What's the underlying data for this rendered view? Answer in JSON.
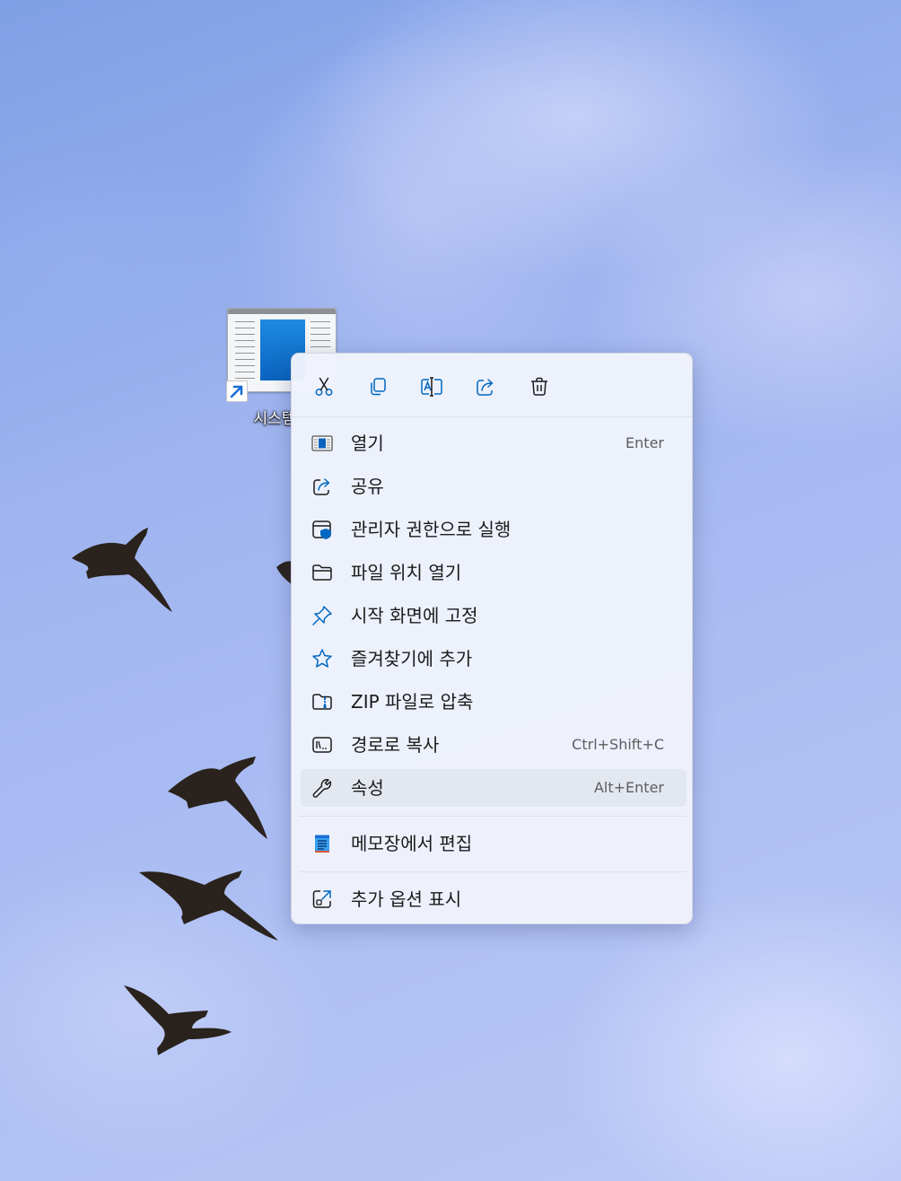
{
  "desktop": {
    "icon_label": "시스템"
  },
  "menu": {
    "toolbar": [
      {
        "name": "cut-icon"
      },
      {
        "name": "copy-icon"
      },
      {
        "name": "rename-icon"
      },
      {
        "name": "share-icon"
      },
      {
        "name": "delete-icon"
      }
    ],
    "items": [
      {
        "label": "열기",
        "shortcut": "Enter",
        "icon": "app-window-icon"
      },
      {
        "label": "공유",
        "shortcut": "",
        "icon": "share-icon"
      },
      {
        "label": "관리자 권한으로 실행",
        "shortcut": "",
        "icon": "admin-shield-icon"
      },
      {
        "label": "파일 위치 열기",
        "shortcut": "",
        "icon": "folder-icon"
      },
      {
        "label": "시작 화면에 고정",
        "shortcut": "",
        "icon": "pin-icon"
      },
      {
        "label": "즐겨찾기에 추가",
        "shortcut": "",
        "icon": "star-icon"
      },
      {
        "label": "ZIP 파일로 압축",
        "shortcut": "",
        "icon": "zip-folder-icon"
      },
      {
        "label": "경로로 복사",
        "shortcut": "Ctrl+Shift+C",
        "icon": "copy-path-icon"
      },
      {
        "label": "속성",
        "shortcut": "Alt+Enter",
        "icon": "wrench-icon"
      }
    ],
    "notepad_item": {
      "label": "메모장에서 편집",
      "icon": "notepad-icon"
    },
    "more_item": {
      "label": "추가 옵션 표시",
      "icon": "more-options-icon"
    }
  },
  "colors": {
    "accent": "#0067c0",
    "menu_bg": "#f0f3fc",
    "highlight": "#e3e7ef"
  }
}
